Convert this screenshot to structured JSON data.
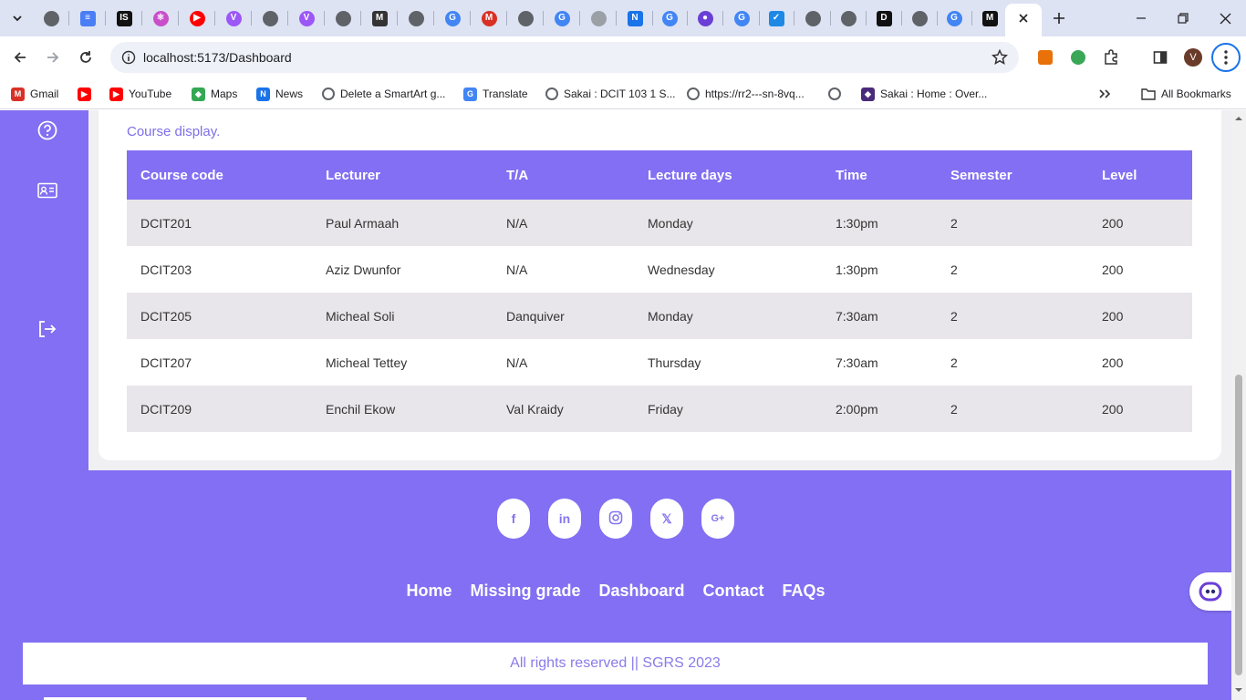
{
  "browser": {
    "url": "localhost:5173/Dashboard",
    "tab_favicons": [
      {
        "icon": "chrome-icon",
        "color": "#5f6368"
      },
      {
        "icon": "docs-icon",
        "color": "#4a7ef5"
      },
      {
        "icon": "is-icon",
        "color": "#111111"
      },
      {
        "icon": "react-icon",
        "color": "#c94fc9"
      },
      {
        "icon": "youtube-icon",
        "color": "#ff0000"
      },
      {
        "icon": "vite-icon",
        "color": "#9c57f7"
      },
      {
        "icon": "chrome-icon",
        "color": "#5f6368"
      },
      {
        "icon": "vite-icon",
        "color": "#9c57f7"
      },
      {
        "icon": "chrome-icon",
        "color": "#5f6368"
      },
      {
        "icon": "medium-icon",
        "color": "#333333"
      },
      {
        "icon": "chrome-icon",
        "color": "#5f6368"
      },
      {
        "icon": "google-icon",
        "color": "#4285f4"
      },
      {
        "icon": "gmail-icon",
        "color": "#d93025"
      },
      {
        "icon": "globe-icon",
        "color": "#5f6368"
      },
      {
        "icon": "google-icon",
        "color": "#4285f4"
      },
      {
        "icon": "globe-icon",
        "color": "#9aa0a6"
      },
      {
        "icon": "news-icon",
        "color": "#1a73e8"
      },
      {
        "icon": "google-icon",
        "color": "#4285f4"
      },
      {
        "icon": "copilot-icon",
        "color": "#6b3fd6"
      },
      {
        "icon": "google-icon",
        "color": "#4285f4"
      },
      {
        "icon": "check-icon",
        "color": "#1e88e5"
      },
      {
        "icon": "globe-icon",
        "color": "#5f6368"
      },
      {
        "icon": "globe-icon",
        "color": "#5f6368"
      },
      {
        "icon": "dev-icon",
        "color": "#111111"
      },
      {
        "icon": "globe-icon",
        "color": "#5f6368"
      },
      {
        "icon": "google-icon",
        "color": "#4285f4"
      },
      {
        "icon": "medium-icon",
        "color": "#111111"
      }
    ],
    "bookmarks": [
      {
        "label": "Gmail",
        "icon": "gmail-icon",
        "color": "#d93025"
      },
      {
        "label": "",
        "icon": "youtube-icon",
        "color": "#ff0000"
      },
      {
        "label": "YouTube",
        "icon": "youtube-icon",
        "color": "#ff0000"
      },
      {
        "label": "Maps",
        "icon": "maps-icon",
        "color": "#34a853"
      },
      {
        "label": "News",
        "icon": "news-icon",
        "color": "#1a73e8"
      },
      {
        "label": "Delete a SmartArt g...",
        "icon": "globe-icon",
        "color": "#5f6368"
      },
      {
        "label": "Translate",
        "icon": "translate-icon",
        "color": "#4285f4"
      },
      {
        "label": "Sakai : DCIT 103 1 S...",
        "icon": "globe-icon",
        "color": "#5f6368"
      },
      {
        "label": "https://rr2---sn-8vq...",
        "icon": "globe-icon",
        "color": "#5f6368"
      },
      {
        "label": "",
        "icon": "globe-icon",
        "color": "#5f6368"
      },
      {
        "label": "Sakai : Home : Over...",
        "icon": "crest-icon",
        "color": "#4a2a7a"
      }
    ],
    "all_bookmarks_label": "All Bookmarks",
    "profile_initial": "V"
  },
  "main": {
    "caption": "Course display.",
    "columns": [
      "Course code",
      "Lecturer",
      "T/A",
      "Lecture days",
      "Time",
      "Semester",
      "Level"
    ],
    "rows": [
      [
        "DCIT201",
        "Paul Armaah",
        "N/A",
        "Monday",
        "1:30pm",
        "2",
        "200"
      ],
      [
        "DCIT203",
        "Aziz Dwunfor",
        "N/A",
        "Wednesday",
        "1:30pm",
        "2",
        "200"
      ],
      [
        "DCIT205",
        "Micheal Soli",
        "Danquiver",
        "Monday",
        "7:30am",
        "2",
        "200"
      ],
      [
        "DCIT207",
        "Micheal Tettey",
        "N/A",
        "Thursday",
        "7:30am",
        "2",
        "200"
      ],
      [
        "DCIT209",
        "Enchil Ekow",
        "Val Kraidy",
        "Friday",
        "2:00pm",
        "2",
        "200"
      ]
    ]
  },
  "sidebar": {
    "icons": [
      "help-icon",
      "contact-card-icon",
      "logout-icon"
    ]
  },
  "footer": {
    "social": [
      {
        "icon": "facebook-icon",
        "glyph": "f"
      },
      {
        "icon": "linkedin-icon",
        "glyph": "in"
      },
      {
        "icon": "instagram-icon",
        "glyph": ""
      },
      {
        "icon": "x-icon",
        "glyph": "𝕏"
      },
      {
        "icon": "google-plus-icon",
        "glyph": "G+"
      }
    ],
    "links": [
      "Home",
      "Missing grade",
      "Dashboard",
      "Contact",
      "FAQs"
    ],
    "copyright": "All rights reserved || SGRS 2023"
  },
  "colors": {
    "accent": "#836ff3",
    "row_alt": "#e8e6ea",
    "caption_text": "#7e6ee8"
  }
}
